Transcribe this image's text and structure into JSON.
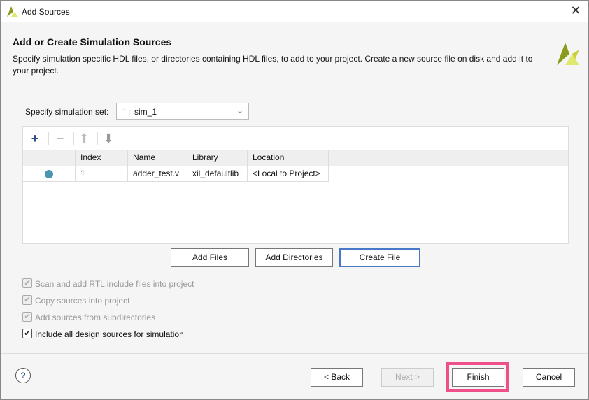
{
  "window": {
    "title": "Add Sources"
  },
  "header": {
    "title": "Add or Create Simulation Sources",
    "description": "Specify simulation specific HDL files, or directories containing HDL files, to add to your project. Create a new source file on disk and add it to your project."
  },
  "simset": {
    "label": "Specify simulation set:",
    "value": "sim_1"
  },
  "table": {
    "columns": [
      "",
      "Index",
      "Name",
      "Library",
      "Location"
    ],
    "rows": [
      {
        "index": "1",
        "name": "adder_test.v",
        "library": "xil_defaultlib",
        "location": "<Local to Project>"
      }
    ]
  },
  "buttons": {
    "add_files": "Add Files",
    "add_directories": "Add Directories",
    "create_file": "Create File",
    "back": "< Back",
    "next": "Next >",
    "finish": "Finish",
    "cancel": "Cancel",
    "help": "?"
  },
  "options": [
    {
      "label": "Scan and add RTL include files into project",
      "checked": true,
      "enabled": false
    },
    {
      "label": "Copy sources into project",
      "checked": true,
      "enabled": false
    },
    {
      "label": "Add sources from subdirectories",
      "checked": true,
      "enabled": false
    },
    {
      "label": "Include all design sources for simulation",
      "checked": true,
      "enabled": true
    }
  ],
  "colors": {
    "accent": "#4a78c8",
    "highlight": "#f0508a",
    "status_dot": "#4a96b0"
  }
}
